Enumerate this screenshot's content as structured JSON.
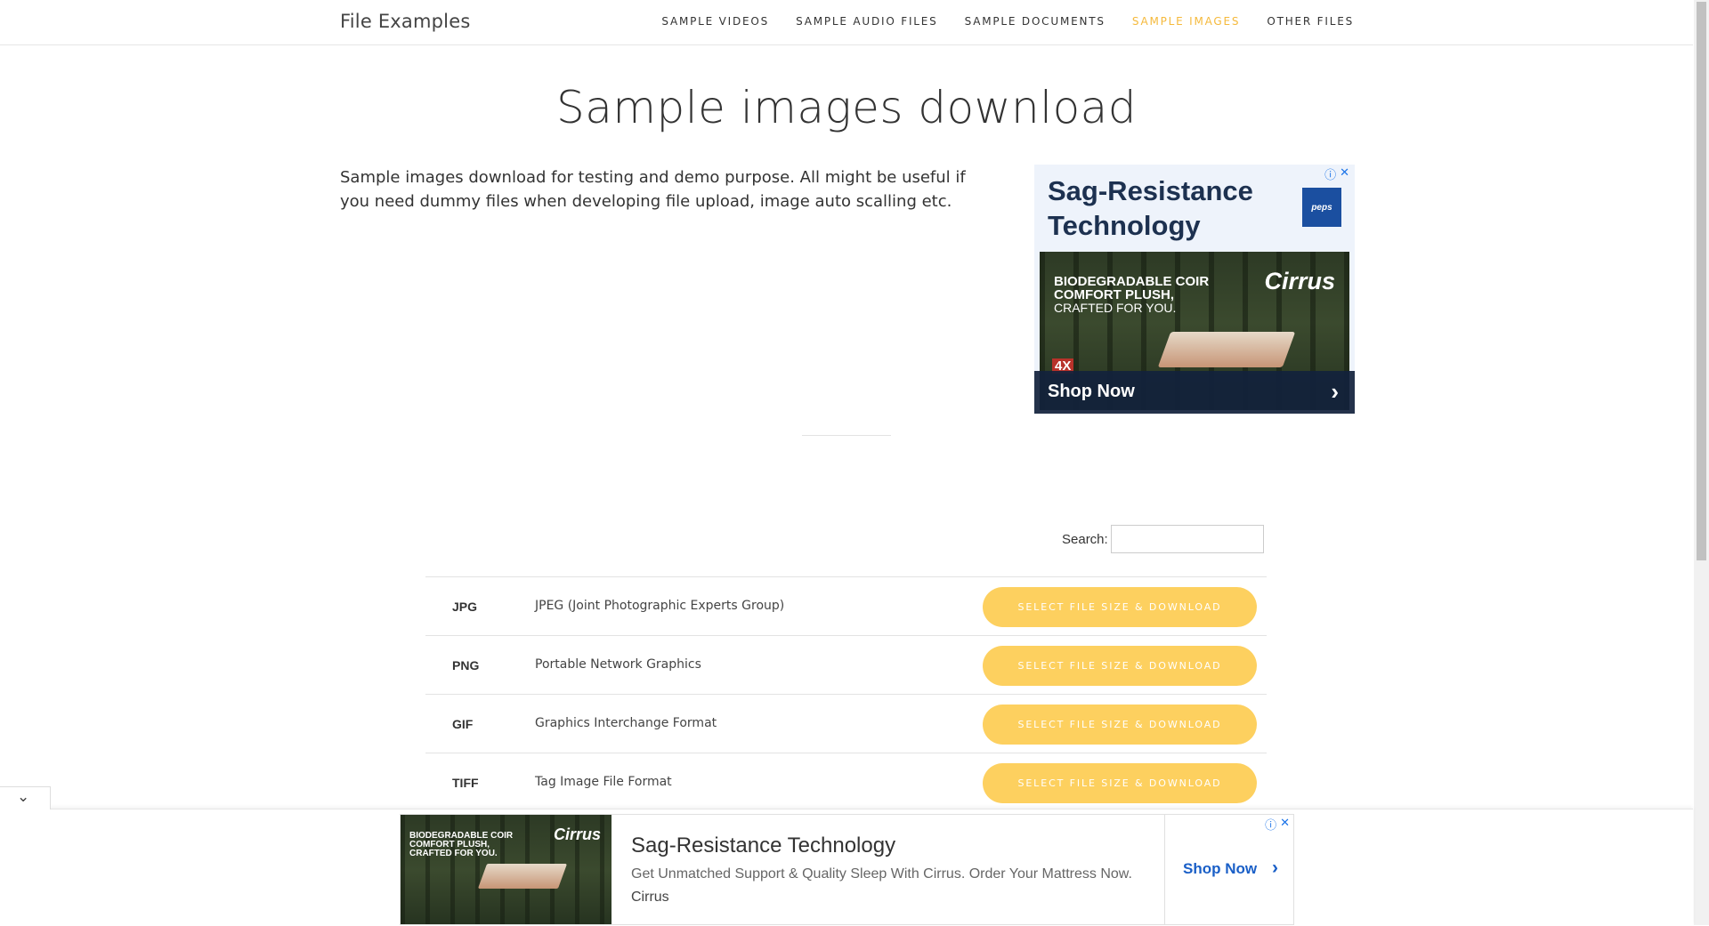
{
  "header": {
    "site_title": "File Examples",
    "nav": [
      {
        "label": "SAMPLE VIDEOS"
      },
      {
        "label": "SAMPLE AUDIO FILES"
      },
      {
        "label": "SAMPLE DOCUMENTS"
      },
      {
        "label": "SAMPLE IMAGES",
        "active": true
      },
      {
        "label": "OTHER FILES"
      }
    ],
    "active_color": "#f5b93b"
  },
  "main": {
    "title": "Sample images download",
    "intro": "Sample images download for testing and demo purpose. All might be useful if you need dummy files when developing file upload, image auto scalling etc."
  },
  "top_ad": {
    "headline": "Sag-Resistance Technology",
    "brand_box": "peps",
    "image_copy_line1": "BIODEGRADABLE COIR",
    "image_copy_line2": "COMFORT PLUSH,",
    "image_copy_line3": "CRAFTED FOR YOU.",
    "image_logo": "Cirrus",
    "badge": "4X",
    "shop_label": "Shop Now",
    "arrow": "›",
    "info_icon": "ⓘ",
    "close_icon": "✕"
  },
  "search": {
    "label": "Search:",
    "value": ""
  },
  "table": {
    "rows": [
      {
        "ext": "JPG",
        "desc": "JPEG (Joint Photographic Experts Group)",
        "button": "SELECT FILE SIZE & DOWNLOAD"
      },
      {
        "ext": "PNG",
        "desc": "Portable Network Graphics",
        "button": "SELECT FILE SIZE & DOWNLOAD"
      },
      {
        "ext": "GIF",
        "desc": "Graphics Interchange Format",
        "button": "SELECT FILE SIZE & DOWNLOAD"
      },
      {
        "ext": "TIFF",
        "desc": "Tag Image File Format",
        "button": "SELECT FILE SIZE & DOWNLOAD"
      }
    ],
    "button_color": "#fdd05f"
  },
  "bottom_ad": {
    "collapse_icon": "⌄",
    "image_copy_line1": "BIODEGRADABLE COIR",
    "image_copy_line2": "COMFORT PLUSH,",
    "image_copy_line3": "CRAFTED FOR YOU.",
    "image_logo": "Cirrus",
    "headline": "Sag-Resistance Technology",
    "sub": "Get Unmatched Support & Quality Sleep With Cirrus. Order Your Mattress Now.",
    "advertiser": "Cirrus",
    "cta": "Shop Now",
    "cta_arrow": "›",
    "info_icon": "ⓘ",
    "close_icon": "✕"
  }
}
